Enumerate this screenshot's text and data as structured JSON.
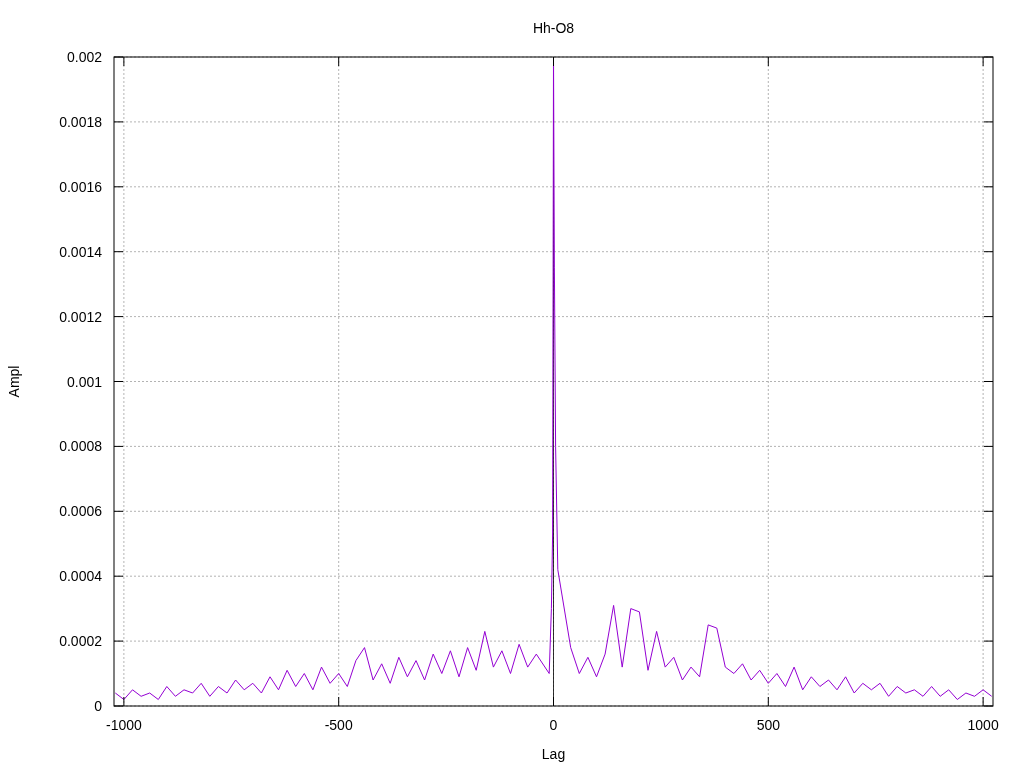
{
  "chart_data": {
    "type": "line",
    "grid": true,
    "title": "Hh-O8",
    "xlabel": "Lag",
    "ylabel": "Ampl",
    "xlim": [
      -1023,
      1023
    ],
    "ylim": [
      0,
      0.002
    ],
    "xticks": [
      -1000,
      -500,
      0,
      500,
      1000
    ],
    "yticks": [
      0,
      0.0002,
      0.0004,
      0.0006,
      0.0008,
      0.001,
      0.0012,
      0.0014,
      0.0016,
      0.0018,
      0.002
    ],
    "x": [
      -1020,
      -1000,
      -980,
      -960,
      -940,
      -920,
      -900,
      -880,
      -860,
      -840,
      -820,
      -800,
      -780,
      -760,
      -740,
      -720,
      -700,
      -680,
      -660,
      -640,
      -620,
      -600,
      -580,
      -560,
      -540,
      -520,
      -500,
      -480,
      -460,
      -440,
      -420,
      -400,
      -380,
      -360,
      -340,
      -320,
      -300,
      -280,
      -260,
      -240,
      -220,
      -200,
      -180,
      -160,
      -140,
      -120,
      -100,
      -80,
      -60,
      -40,
      -10,
      -5,
      -2,
      0,
      2,
      5,
      10,
      40,
      60,
      80,
      100,
      120,
      140,
      160,
      180,
      200,
      220,
      240,
      260,
      280,
      300,
      320,
      340,
      360,
      380,
      400,
      420,
      440,
      460,
      480,
      500,
      520,
      540,
      560,
      580,
      600,
      620,
      640,
      660,
      680,
      700,
      720,
      740,
      760,
      780,
      800,
      820,
      840,
      860,
      880,
      900,
      920,
      940,
      960,
      980,
      1000,
      1020
    ],
    "series": [
      {
        "color": "#9400d3",
        "values": [
          4e-05,
          2e-05,
          5e-05,
          3e-05,
          4e-05,
          2e-05,
          6e-05,
          3e-05,
          5e-05,
          4e-05,
          7e-05,
          3e-05,
          6e-05,
          4e-05,
          8e-05,
          5e-05,
          7e-05,
          4e-05,
          9e-05,
          5e-05,
          0.00011,
          6e-05,
          0.0001,
          5e-05,
          0.00012,
          7e-05,
          0.0001,
          6e-05,
          0.00014,
          0.00018,
          8e-05,
          0.00013,
          7e-05,
          0.00015,
          9e-05,
          0.00014,
          8e-05,
          0.00016,
          0.0001,
          0.00017,
          9e-05,
          0.00018,
          0.00011,
          0.00023,
          0.00012,
          0.00017,
          0.0001,
          0.00019,
          0.00012,
          0.00016,
          0.0001,
          0.0003,
          0.00053,
          0.002,
          0.00135,
          0.0008,
          0.00042,
          0.00018,
          0.0001,
          0.00015,
          9e-05,
          0.00016,
          0.00031,
          0.00012,
          0.0003,
          0.00029,
          0.00011,
          0.00023,
          0.00012,
          0.00015,
          8e-05,
          0.00012,
          9e-05,
          0.00025,
          0.00024,
          0.00012,
          0.0001,
          0.00013,
          8e-05,
          0.00011,
          7e-05,
          0.0001,
          6e-05,
          0.00012,
          5e-05,
          9e-05,
          6e-05,
          8e-05,
          5e-05,
          9e-05,
          4e-05,
          7e-05,
          5e-05,
          7e-05,
          3e-05,
          6e-05,
          4e-05,
          5e-05,
          3e-05,
          6e-05,
          3e-05,
          5e-05,
          2e-05,
          4e-05,
          3e-05,
          5e-05,
          3e-05
        ]
      }
    ]
  }
}
